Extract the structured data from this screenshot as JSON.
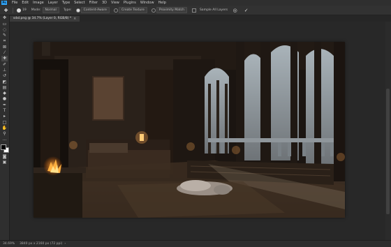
{
  "app": {
    "logo": "Ps"
  },
  "menu": [
    "File",
    "Edit",
    "Image",
    "Layer",
    "Type",
    "Select",
    "Filter",
    "3D",
    "View",
    "Plugins",
    "Window",
    "Help"
  ],
  "options": {
    "brush_size": "19",
    "mode_label": "Mode:",
    "mode_value": "Normal",
    "type_label": "Type:",
    "type_content_aware": "Content-Aware",
    "type_create_texture": "Create Texture",
    "type_proximity_match": "Proximity Match",
    "sample_all_layers": "Sample All Layers"
  },
  "document": {
    "tab_title": "sdxl.png @ 34.7% (Layer 0, RGB/8) *",
    "close_glyph": "×"
  },
  "status": {
    "zoom": "34.69%",
    "doc_info": "3840 px x 2160 px (72 ppi)",
    "arrow_glyph": "›"
  },
  "colors": {
    "accent": "#31a8ff",
    "foreground_swatch": "#000000",
    "background_swatch": "#ffffff"
  },
  "tools": [
    {
      "name": "move-tool-icon",
      "glyph": "✥"
    },
    {
      "name": "artboard-tool-icon",
      "glyph": "▭"
    },
    {
      "name": "lasso-tool-icon",
      "glyph": "◌"
    },
    {
      "name": "quick-select-tool-icon",
      "glyph": "✎"
    },
    {
      "name": "crop-tool-icon",
      "glyph": "⌗"
    },
    {
      "name": "frame-tool-icon",
      "glyph": "⊠"
    },
    {
      "name": "eyedropper-tool-icon",
      "glyph": "⁄"
    },
    {
      "name": "spot-healing-tool-icon",
      "glyph": "✚"
    },
    {
      "name": "brush-tool-icon",
      "glyph": "✐"
    },
    {
      "name": "clone-stamp-tool-icon",
      "glyph": "⊥"
    },
    {
      "name": "history-brush-tool-icon",
      "glyph": "↺"
    },
    {
      "name": "eraser-tool-icon",
      "glyph": "◩"
    },
    {
      "name": "gradient-tool-icon",
      "glyph": "▤"
    },
    {
      "name": "blur-tool-icon",
      "glyph": "◆"
    },
    {
      "name": "dodge-tool-icon",
      "glyph": "●"
    },
    {
      "name": "pen-tool-icon",
      "glyph": "✒"
    },
    {
      "name": "type-tool-icon",
      "glyph": "T"
    },
    {
      "name": "path-select-tool-icon",
      "glyph": "▸"
    },
    {
      "name": "rectangle-tool-icon",
      "glyph": "□"
    },
    {
      "name": "hand-tool-icon",
      "glyph": "✋"
    },
    {
      "name": "zoom-tool-icon",
      "glyph": "⚲"
    },
    {
      "name": "more-tools-icon",
      "glyph": "…"
    }
  ],
  "extra_tools": [
    {
      "name": "quick-mask-icon",
      "glyph": "◙"
    },
    {
      "name": "screen-mode-icon",
      "glyph": "▣"
    }
  ]
}
